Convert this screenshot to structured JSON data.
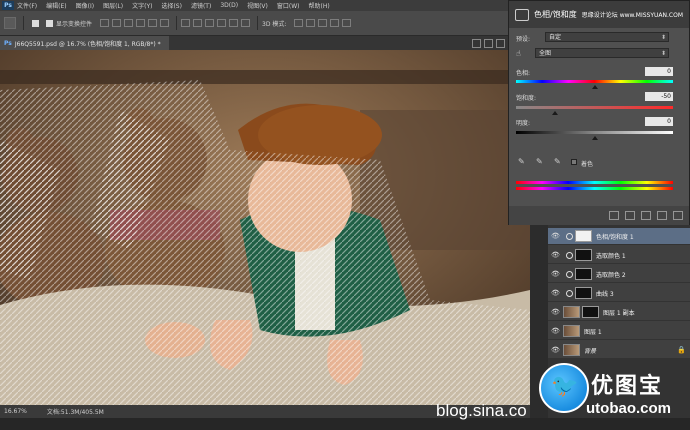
{
  "app": {
    "logo_text": "Ps"
  },
  "menu": {
    "items": [
      "文件(F)",
      "编辑(E)",
      "图像(I)",
      "图层(L)",
      "文字(Y)",
      "选择(S)",
      "滤镜(T)",
      "3D(D)",
      "视图(V)",
      "窗口(W)",
      "帮助(H)"
    ]
  },
  "options_bar": {
    "show_transform_label": "显示变换控件",
    "mode_3d_label": "3D 模式:"
  },
  "document": {
    "tab_title": "J66Q5591.psd @ 16.7% (色相/饱和度 1, RGB/8*) *",
    "zoom": "16.67%",
    "doc_size": "文档:51.3M/405.5M"
  },
  "adjustment_panel": {
    "title": "色相/饱和度",
    "site_watermark": "思缘设计论坛 www.MISSYUAN.COM",
    "preset_label": "预设:",
    "preset_value": "自定",
    "channel_value": "全图",
    "hue_label": "色相:",
    "hue_value": "0",
    "saturation_label": "饱和度:",
    "saturation_value": "-50",
    "lightness_label": "明度:",
    "lightness_value": "0",
    "colorize_label": "着色",
    "hue_level": 0.5,
    "saturation_level": 0.25,
    "lightness_level": 0.5
  },
  "layers": [
    {
      "name": "色相/饱和度 1",
      "kind": "adjustment",
      "selected": true,
      "mask": "white"
    },
    {
      "name": "选取颜色 1",
      "kind": "adjustment",
      "selected": false,
      "mask": "black"
    },
    {
      "name": "选取颜色 2",
      "kind": "adjustment",
      "selected": false,
      "mask": "black"
    },
    {
      "name": "曲线 3",
      "kind": "adjustment",
      "selected": false,
      "mask": "black"
    },
    {
      "name": "图层 1 副本",
      "kind": "pixel",
      "selected": false,
      "mask": "black"
    },
    {
      "name": "图层 1",
      "kind": "pixel",
      "selected": false
    },
    {
      "name": "背景",
      "kind": "pixel",
      "selected": false,
      "locked": true
    }
  ],
  "watermark": {
    "url_text": "blog.sina.co",
    "brand_cn": "优图宝",
    "brand_en": "utobao.com"
  }
}
